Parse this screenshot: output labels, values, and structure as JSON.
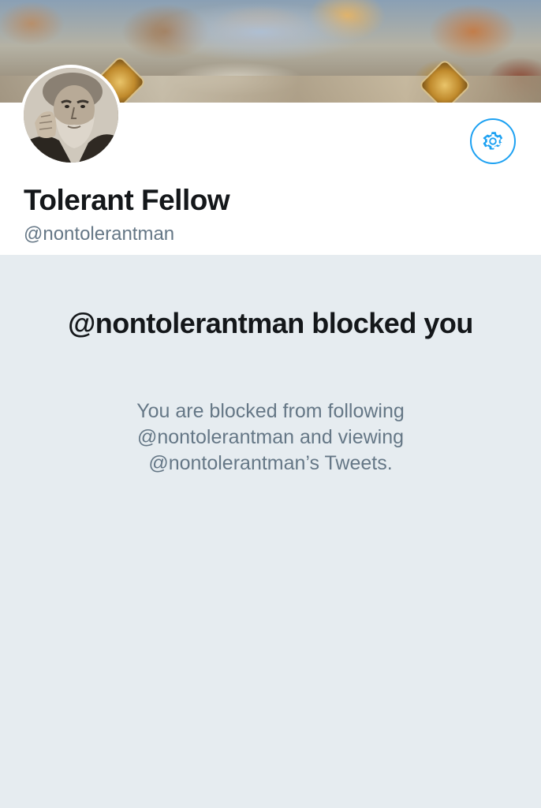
{
  "profile": {
    "display_name": "Tolerant Fellow",
    "screen_name": "@nontolerantman",
    "avatar_icon": "profile-photo-man",
    "settings_icon": "gear-icon"
  },
  "blocked_notice": {
    "title": "@nontolerantman blocked you",
    "description": "You are blocked from following @nontolerantman and viewing @nontolerantman’s Tweets."
  },
  "colors": {
    "accent": "#1da1f2",
    "background": "#e6ecf0",
    "primary_text": "#14171a",
    "secondary_text": "#657786"
  }
}
